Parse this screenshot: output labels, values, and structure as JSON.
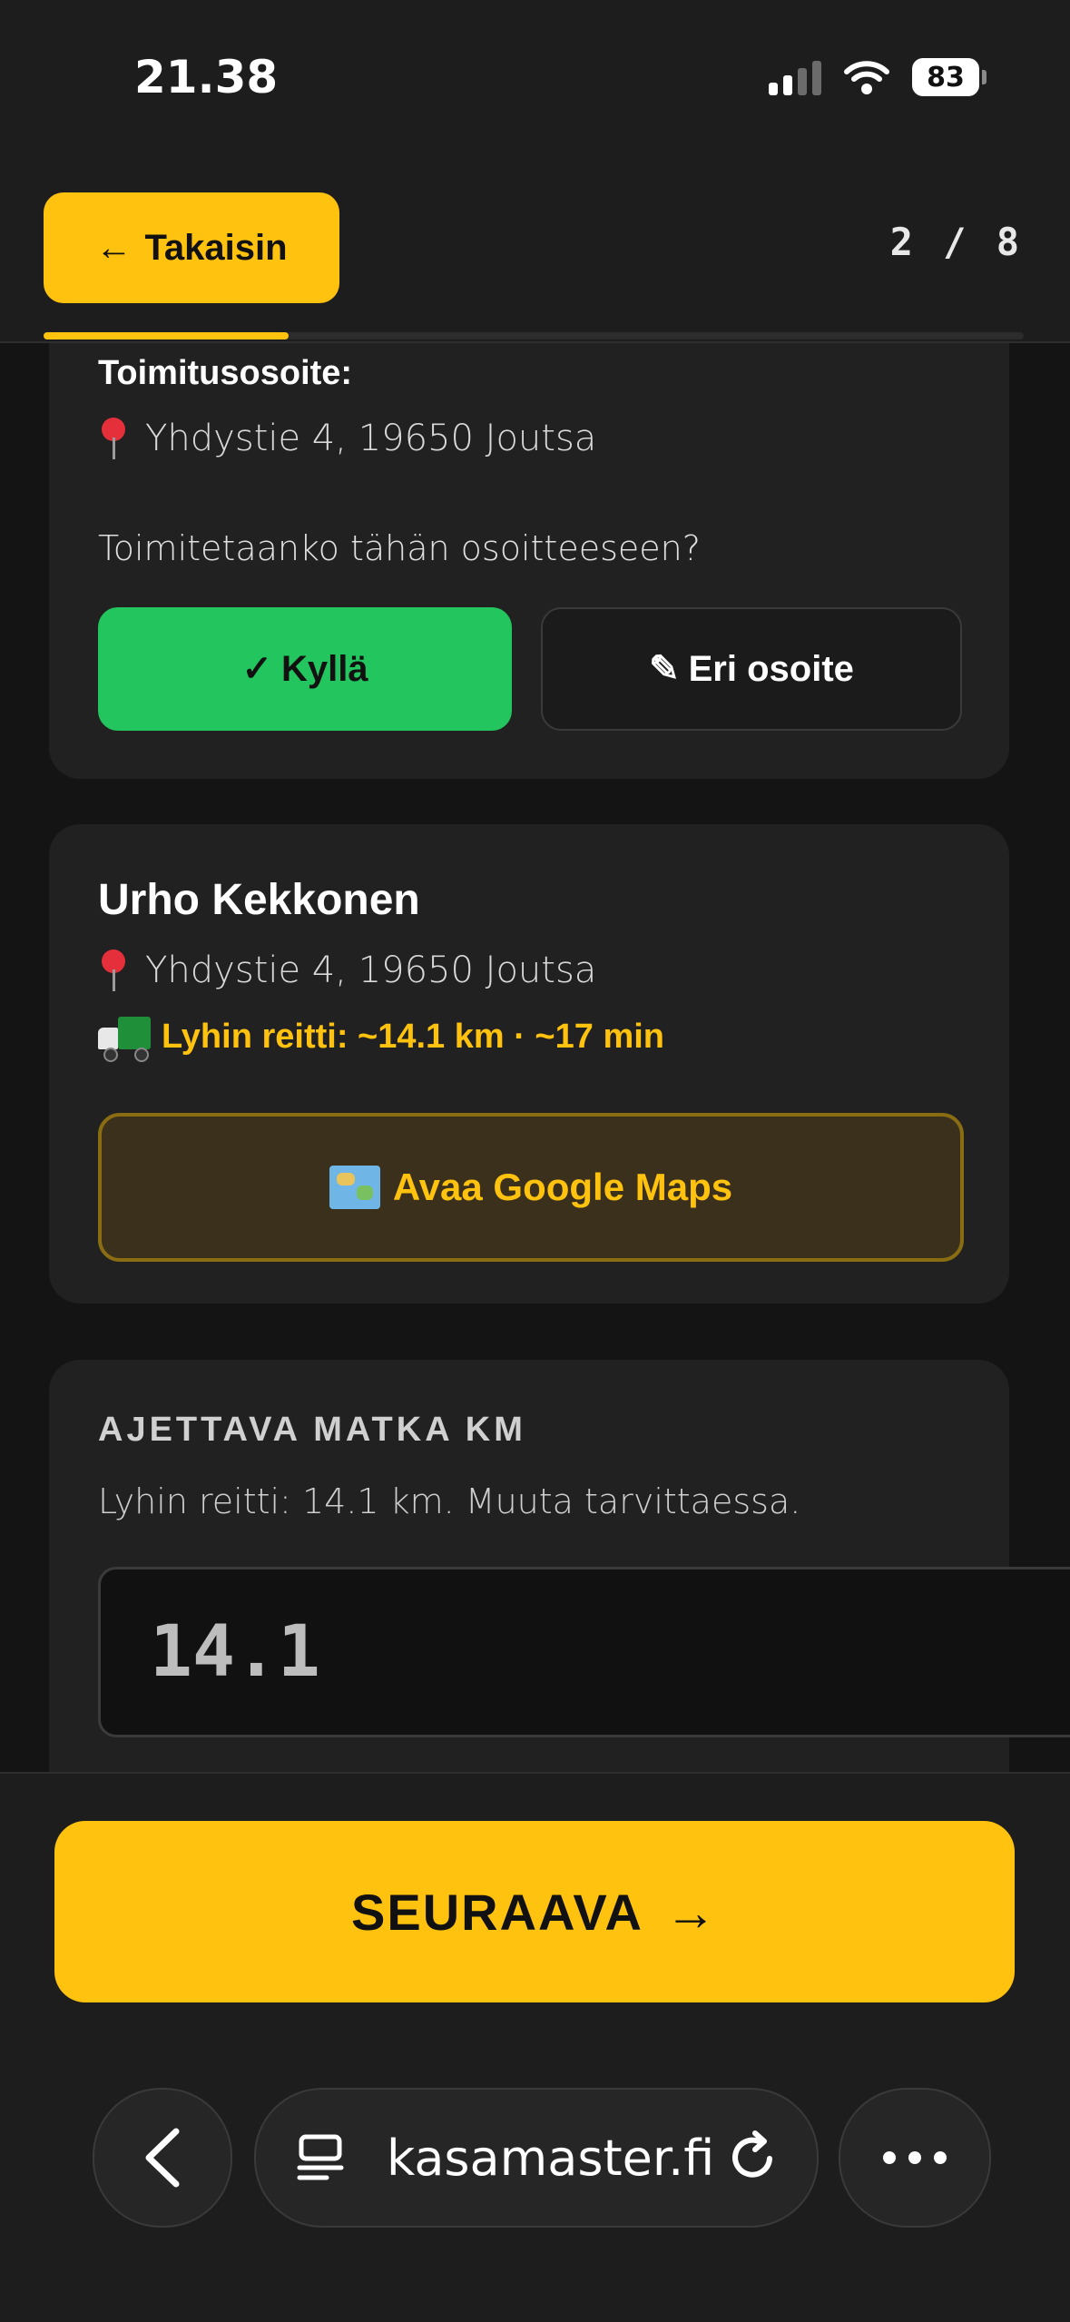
{
  "status_bar": {
    "time": "21.38",
    "battery": "83"
  },
  "header": {
    "back_label": "Takaisin",
    "step": "2 / 8",
    "progress_fraction": 0.25
  },
  "delivery_card": {
    "label": "Toimitusosoite:",
    "address": "Yhdystie 4, 19650 Joutsa",
    "question": "Toimitetaanko tähän osoitteeseen?",
    "yes_label": "Kyllä",
    "other_label": "Eri osoite"
  },
  "customer_card": {
    "name": "Urho Kekkonen",
    "address": "Yhdystie 4, 19650 Joutsa",
    "route": "Lyhin reitti: ~14.1 km · ~17 min",
    "maps_label": "Avaa Google Maps"
  },
  "distance_card": {
    "title": "AJETTAVA MATKA KM",
    "helper": "Lyhin reitti: 14.1 km. Muuta tarvittaessa.",
    "value": "14.1"
  },
  "footer": {
    "next_label": "SEURAAVA"
  },
  "browser": {
    "url": "kasamaster.fi"
  },
  "colors": {
    "accent": "#ffc20e",
    "success": "#22c55e",
    "background": "#141414",
    "card": "#212121"
  }
}
